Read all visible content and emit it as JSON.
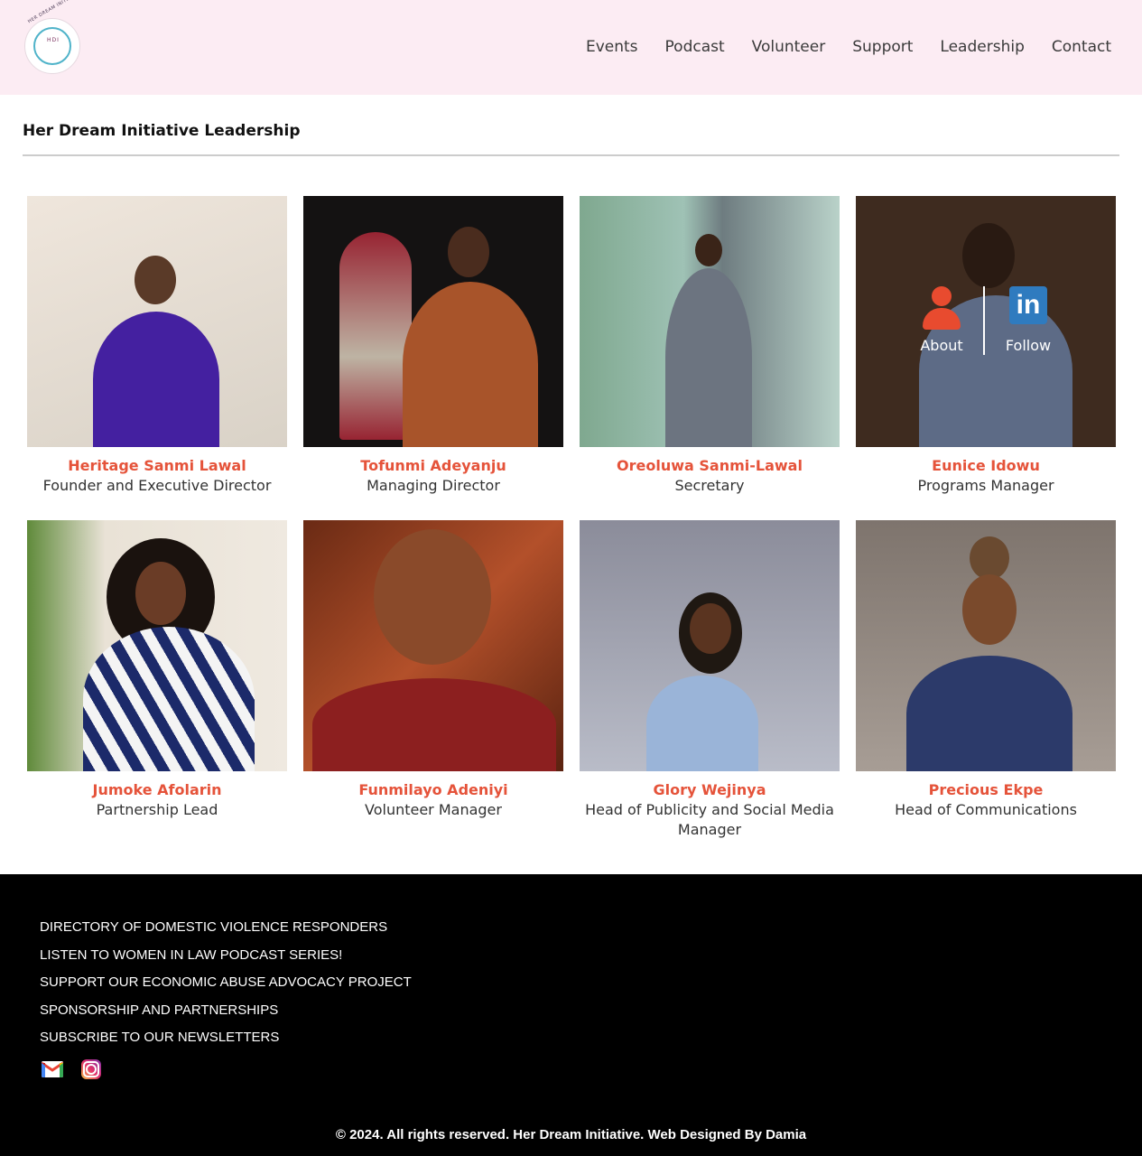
{
  "header": {
    "logo_text": "HER DREAM INITIATIVE",
    "logo_monogram": "HDI",
    "nav": [
      "Events",
      "Podcast",
      "Volunteer",
      "Support",
      "Leadership",
      "Contact"
    ]
  },
  "page": {
    "title": "Her Dream Initiative Leadership"
  },
  "team": [
    {
      "name": "Heritage Sanmi Lawal",
      "role": "Founder and Executive Director"
    },
    {
      "name": "Tofunmi Adeyanju",
      "role": "Managing Director"
    },
    {
      "name": "Oreoluwa Sanmi-Lawal",
      "role": "Secretary"
    },
    {
      "name": "Eunice Idowu",
      "role": "Programs Manager"
    },
    {
      "name": "Jumoke Afolarin",
      "role": "Partnership Lead"
    },
    {
      "name": "Funmilayo Adeniyi",
      "role": "Volunteer Manager"
    },
    {
      "name": "Glory Wejinya",
      "role": "Head of Publicity and Social Media Manager"
    },
    {
      "name": "Precious Ekpe",
      "role": "Head of Communications"
    }
  ],
  "hover_overlay": {
    "about_label": "About",
    "follow_label": "Follow"
  },
  "footer": {
    "links": [
      "DIRECTORY OF DOMESTIC VIOLENCE RESPONDERS",
      "LISTEN TO WOMEN IN LAW PODCAST SERIES!",
      "SUPPORT OUR ECONOMIC ABUSE ADVOCACY PROJECT",
      "SPONSORSHIP AND PARTNERSHIPS",
      "SUBSCRIBE TO OUR NEWSLETTERS"
    ],
    "social_icons": [
      "gmail-icon",
      "instagram-icon"
    ],
    "copyright": "© 2024. All rights reserved. Her Dream Initiative. Web Designed By Damia"
  },
  "colors": {
    "header_bg": "#fcecf3",
    "accent": "#e5533a",
    "footer_bg": "#000000"
  }
}
